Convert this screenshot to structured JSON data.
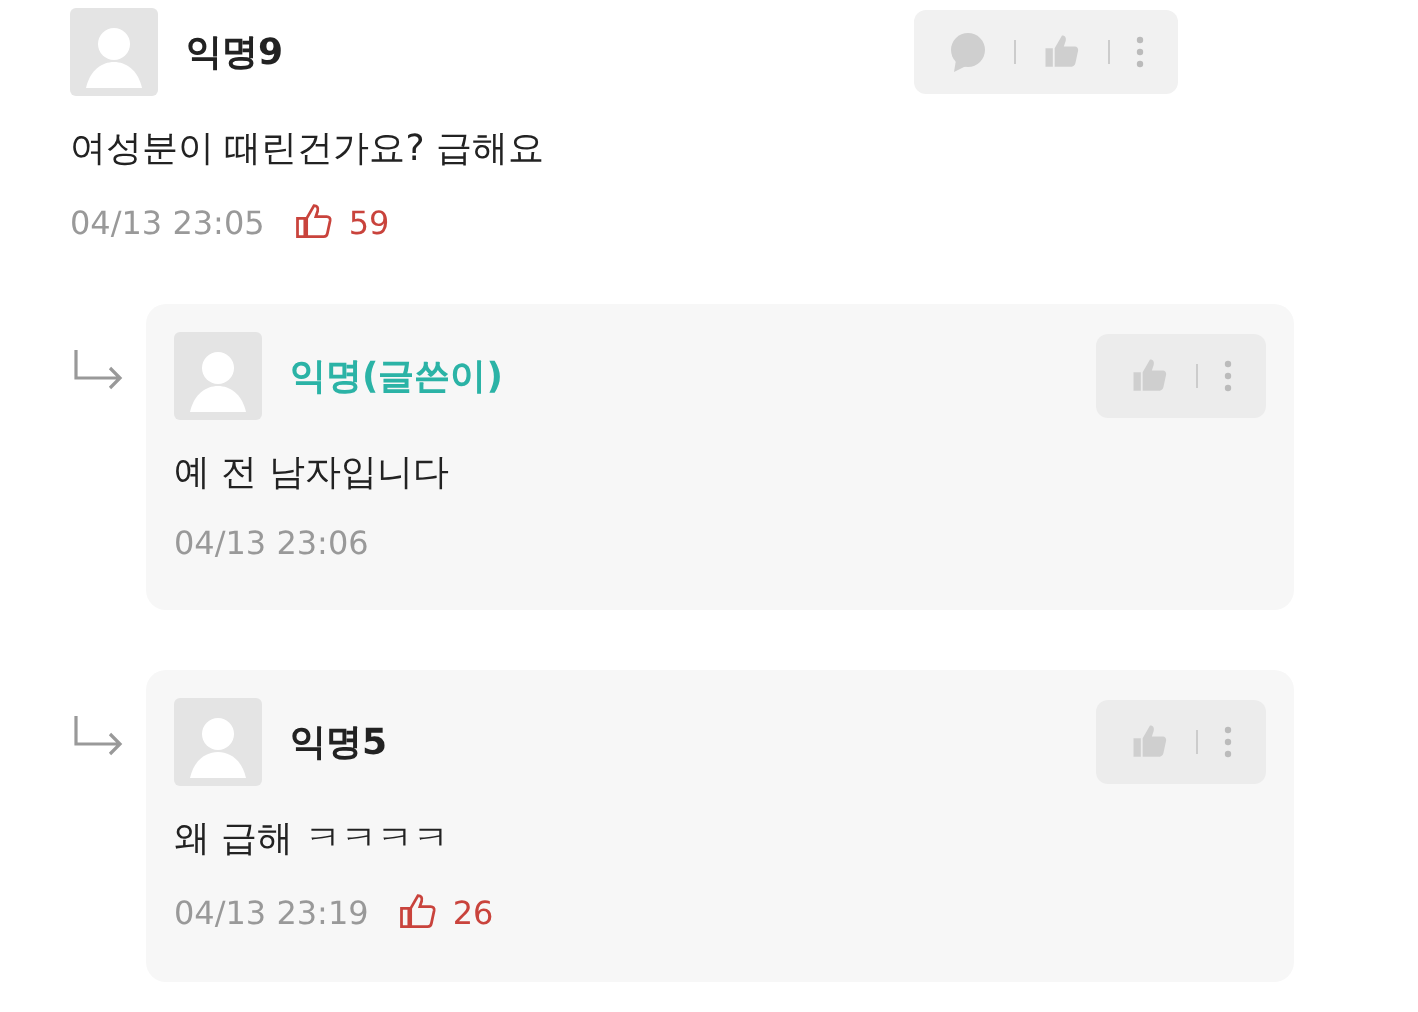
{
  "comments": [
    {
      "author": "익명9",
      "is_writer": false,
      "reply": false,
      "text": "여성분이 때린건가요? 급해요",
      "time": "04/13 23:05",
      "likes": "59",
      "actions": [
        {
          "kind": "comment"
        },
        {
          "kind": "like"
        },
        {
          "kind": "more"
        }
      ]
    },
    {
      "author": "익명(글쓴이)",
      "is_writer": true,
      "reply": true,
      "text": "예 전 남자입니다",
      "time": "04/13 23:06",
      "actions": [
        {
          "kind": "like"
        },
        {
          "kind": "more"
        }
      ]
    },
    {
      "author": "익명5",
      "is_writer": false,
      "reply": true,
      "text": "왜 급해 ㅋㅋㅋㅋ",
      "time": "04/13 23:19",
      "likes": "26",
      "actions": [
        {
          "kind": "like"
        },
        {
          "kind": "more"
        }
      ]
    }
  ]
}
